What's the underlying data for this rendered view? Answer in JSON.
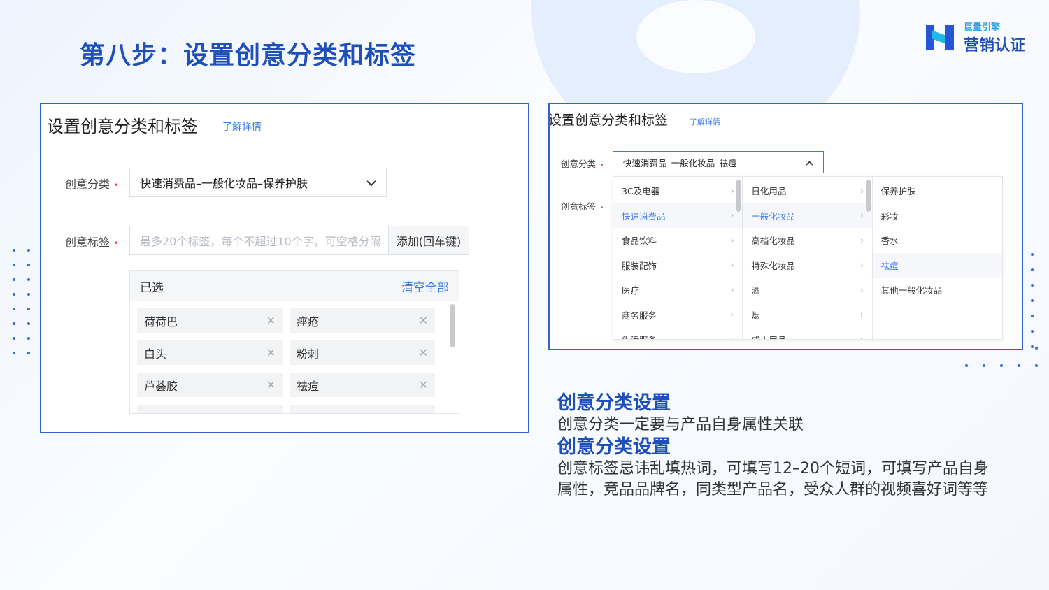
{
  "slide": {
    "title": "第八步：设置创意分类和标签"
  },
  "logo": {
    "small": "巨量引擎",
    "big": "营销认证"
  },
  "left_panel": {
    "title": "设置创意分类和标签",
    "link": "了解详情",
    "category_label": "创意分类",
    "required_mark": "•",
    "category_value": "快速消费品–一般化妆品–保养护肤",
    "tag_label": "创意标签",
    "tag_placeholder": "最多20个标签，每个不超过10个字，可空格分隔",
    "add_button": "添加(回车键)",
    "chosen_title": "已选",
    "clear_all": "清空全部",
    "tags": [
      "荷荷巴",
      "痤疮",
      "白头",
      "粉刺",
      "芦荟胶",
      "祛痘"
    ]
  },
  "right_panel": {
    "title": "设置创意分类和标签",
    "link": "了解详情",
    "category_label": "创意分类",
    "required_mark": "•",
    "category_value": "快速消费品–一般化妆品–祛痘",
    "tag_label": "创意标签",
    "col1": [
      "3C及电器",
      "快速消费品",
      "食品饮料",
      "服装配饰",
      "医疗",
      "商务服务",
      "生活服务"
    ],
    "col2": [
      "日化用品",
      "一般化妆品",
      "高档化妆品",
      "特殊化妆品",
      "酒",
      "烟",
      "成人用品"
    ],
    "col3": [
      "保养护肤",
      "彩妆",
      "香水",
      "祛痘",
      "其他一般化妆品"
    ]
  },
  "description": {
    "heading1": "创意分类设置",
    "text1": "创意分类一定要与产品自身属性关联",
    "heading2": "创意分类设置",
    "text2": "创意标签忌讳乱填热词，可填写12–20个短词，可填写产品自身属性，竞品品牌名，同类型产品名，受众人群的视频喜好词等等"
  }
}
